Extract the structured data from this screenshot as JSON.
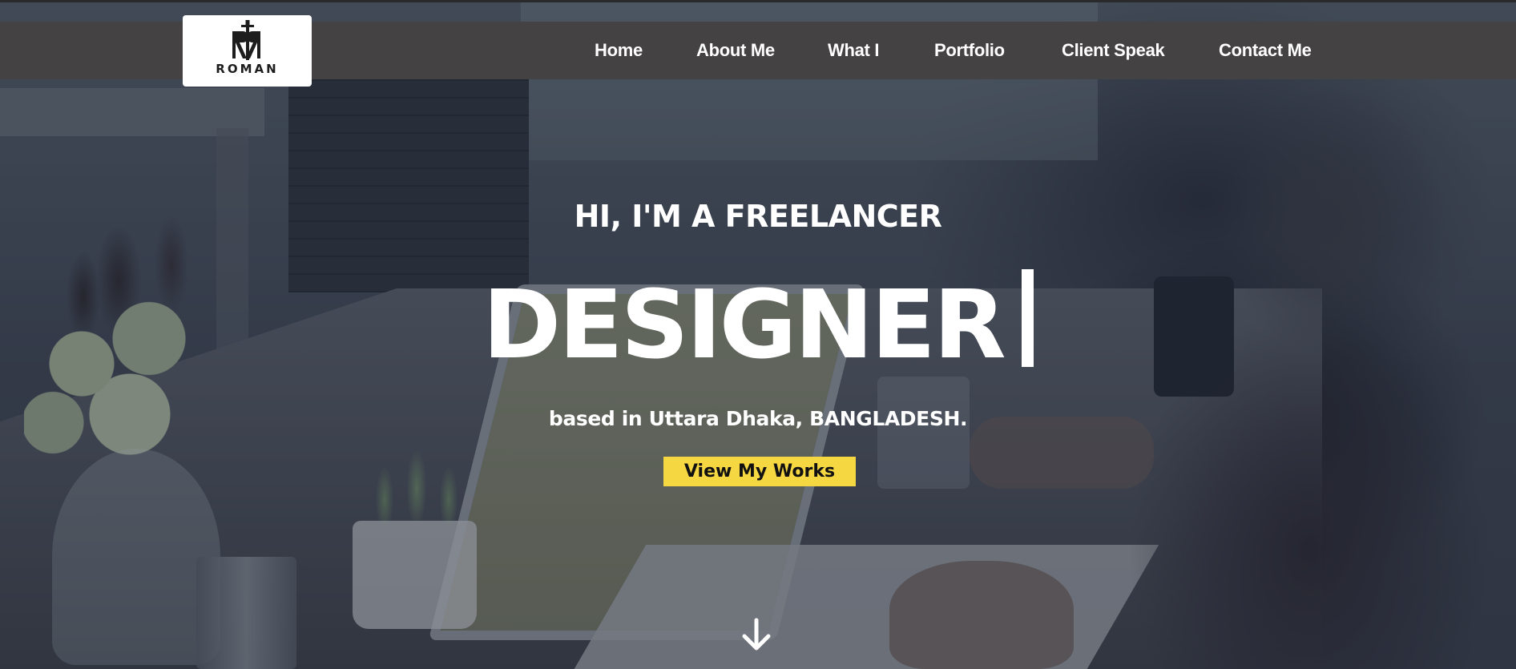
{
  "brand": {
    "logo_text": "ROMAN",
    "logo_icon": "roman-sword-monogram-icon"
  },
  "nav": {
    "items": [
      {
        "label": "Home"
      },
      {
        "label": "About Me"
      },
      {
        "label": "What I"
      },
      {
        "label": "Portfolio"
      },
      {
        "label": "Client Speak"
      },
      {
        "label": "Contact Me"
      }
    ]
  },
  "hero": {
    "subtitle": "HI, I'M A FREELANCER",
    "role": "DESIGNER",
    "location": "based in Uttara Dhaka, BANGLADESH.",
    "cta_label": "View My Works",
    "scroll_icon": "arrow-down-icon"
  },
  "colors": {
    "navbar_bg": "#454243",
    "cta_bg": "#f5d742",
    "text": "#ffffff"
  }
}
